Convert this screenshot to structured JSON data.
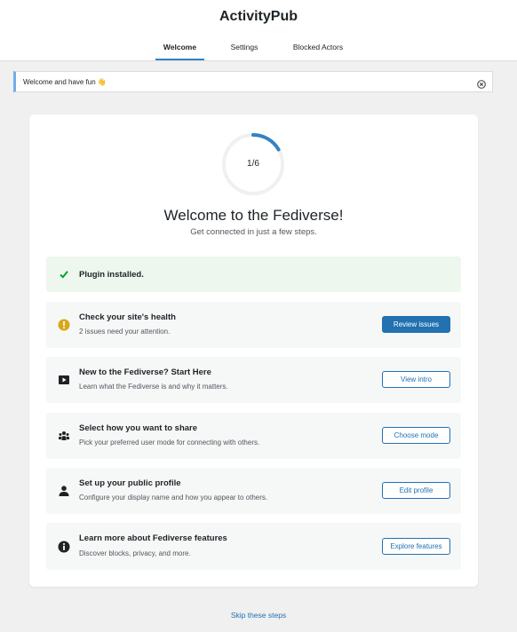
{
  "app": {
    "title": "ActivityPub"
  },
  "tabs": [
    {
      "label": "Welcome",
      "active": true
    },
    {
      "label": "Settings",
      "active": false
    },
    {
      "label": "Blocked Actors",
      "active": false
    }
  ],
  "notice": {
    "text": "Welcome and have fun 👋",
    "dismiss_icon": "close-circle-icon"
  },
  "progress": {
    "text": "1/6",
    "completed": 1,
    "total": 6
  },
  "welcome": {
    "title": "Welcome to the Fediverse!",
    "subtitle": "Get connected in just a few steps."
  },
  "steps": [
    {
      "title": "Plugin installed.",
      "icon": "checkmark-icon",
      "status": "done"
    },
    {
      "title": "Check your site's health",
      "description": "2 issues need your attention.",
      "button": "Review issues",
      "icon": "warning-icon"
    },
    {
      "title": "New to the Fediverse? Start Here",
      "description": "Learn what the Fediverse is and why it matters.",
      "button": "View intro",
      "icon": "video-icon"
    },
    {
      "title": "Select how you want to share",
      "description": "Pick your preferred user mode for connecting with others.",
      "button": "Choose mode",
      "icon": "groups-icon"
    },
    {
      "title": "Set up your public profile",
      "description": "Configure your display name and how you appear to others.",
      "button": "Edit profile",
      "icon": "user-icon"
    },
    {
      "title": "Learn more about Fediverse features",
      "description": "Discover blocks, privacy, and more.",
      "button": "Explore features",
      "icon": "info-icon"
    }
  ],
  "skip": {
    "label": "Skip these steps"
  },
  "colors": {
    "accent": "#2271b1",
    "ring": "#3582c4",
    "success": "#00a32a",
    "warning": "#dba617",
    "notice_border": "#72aee6"
  }
}
